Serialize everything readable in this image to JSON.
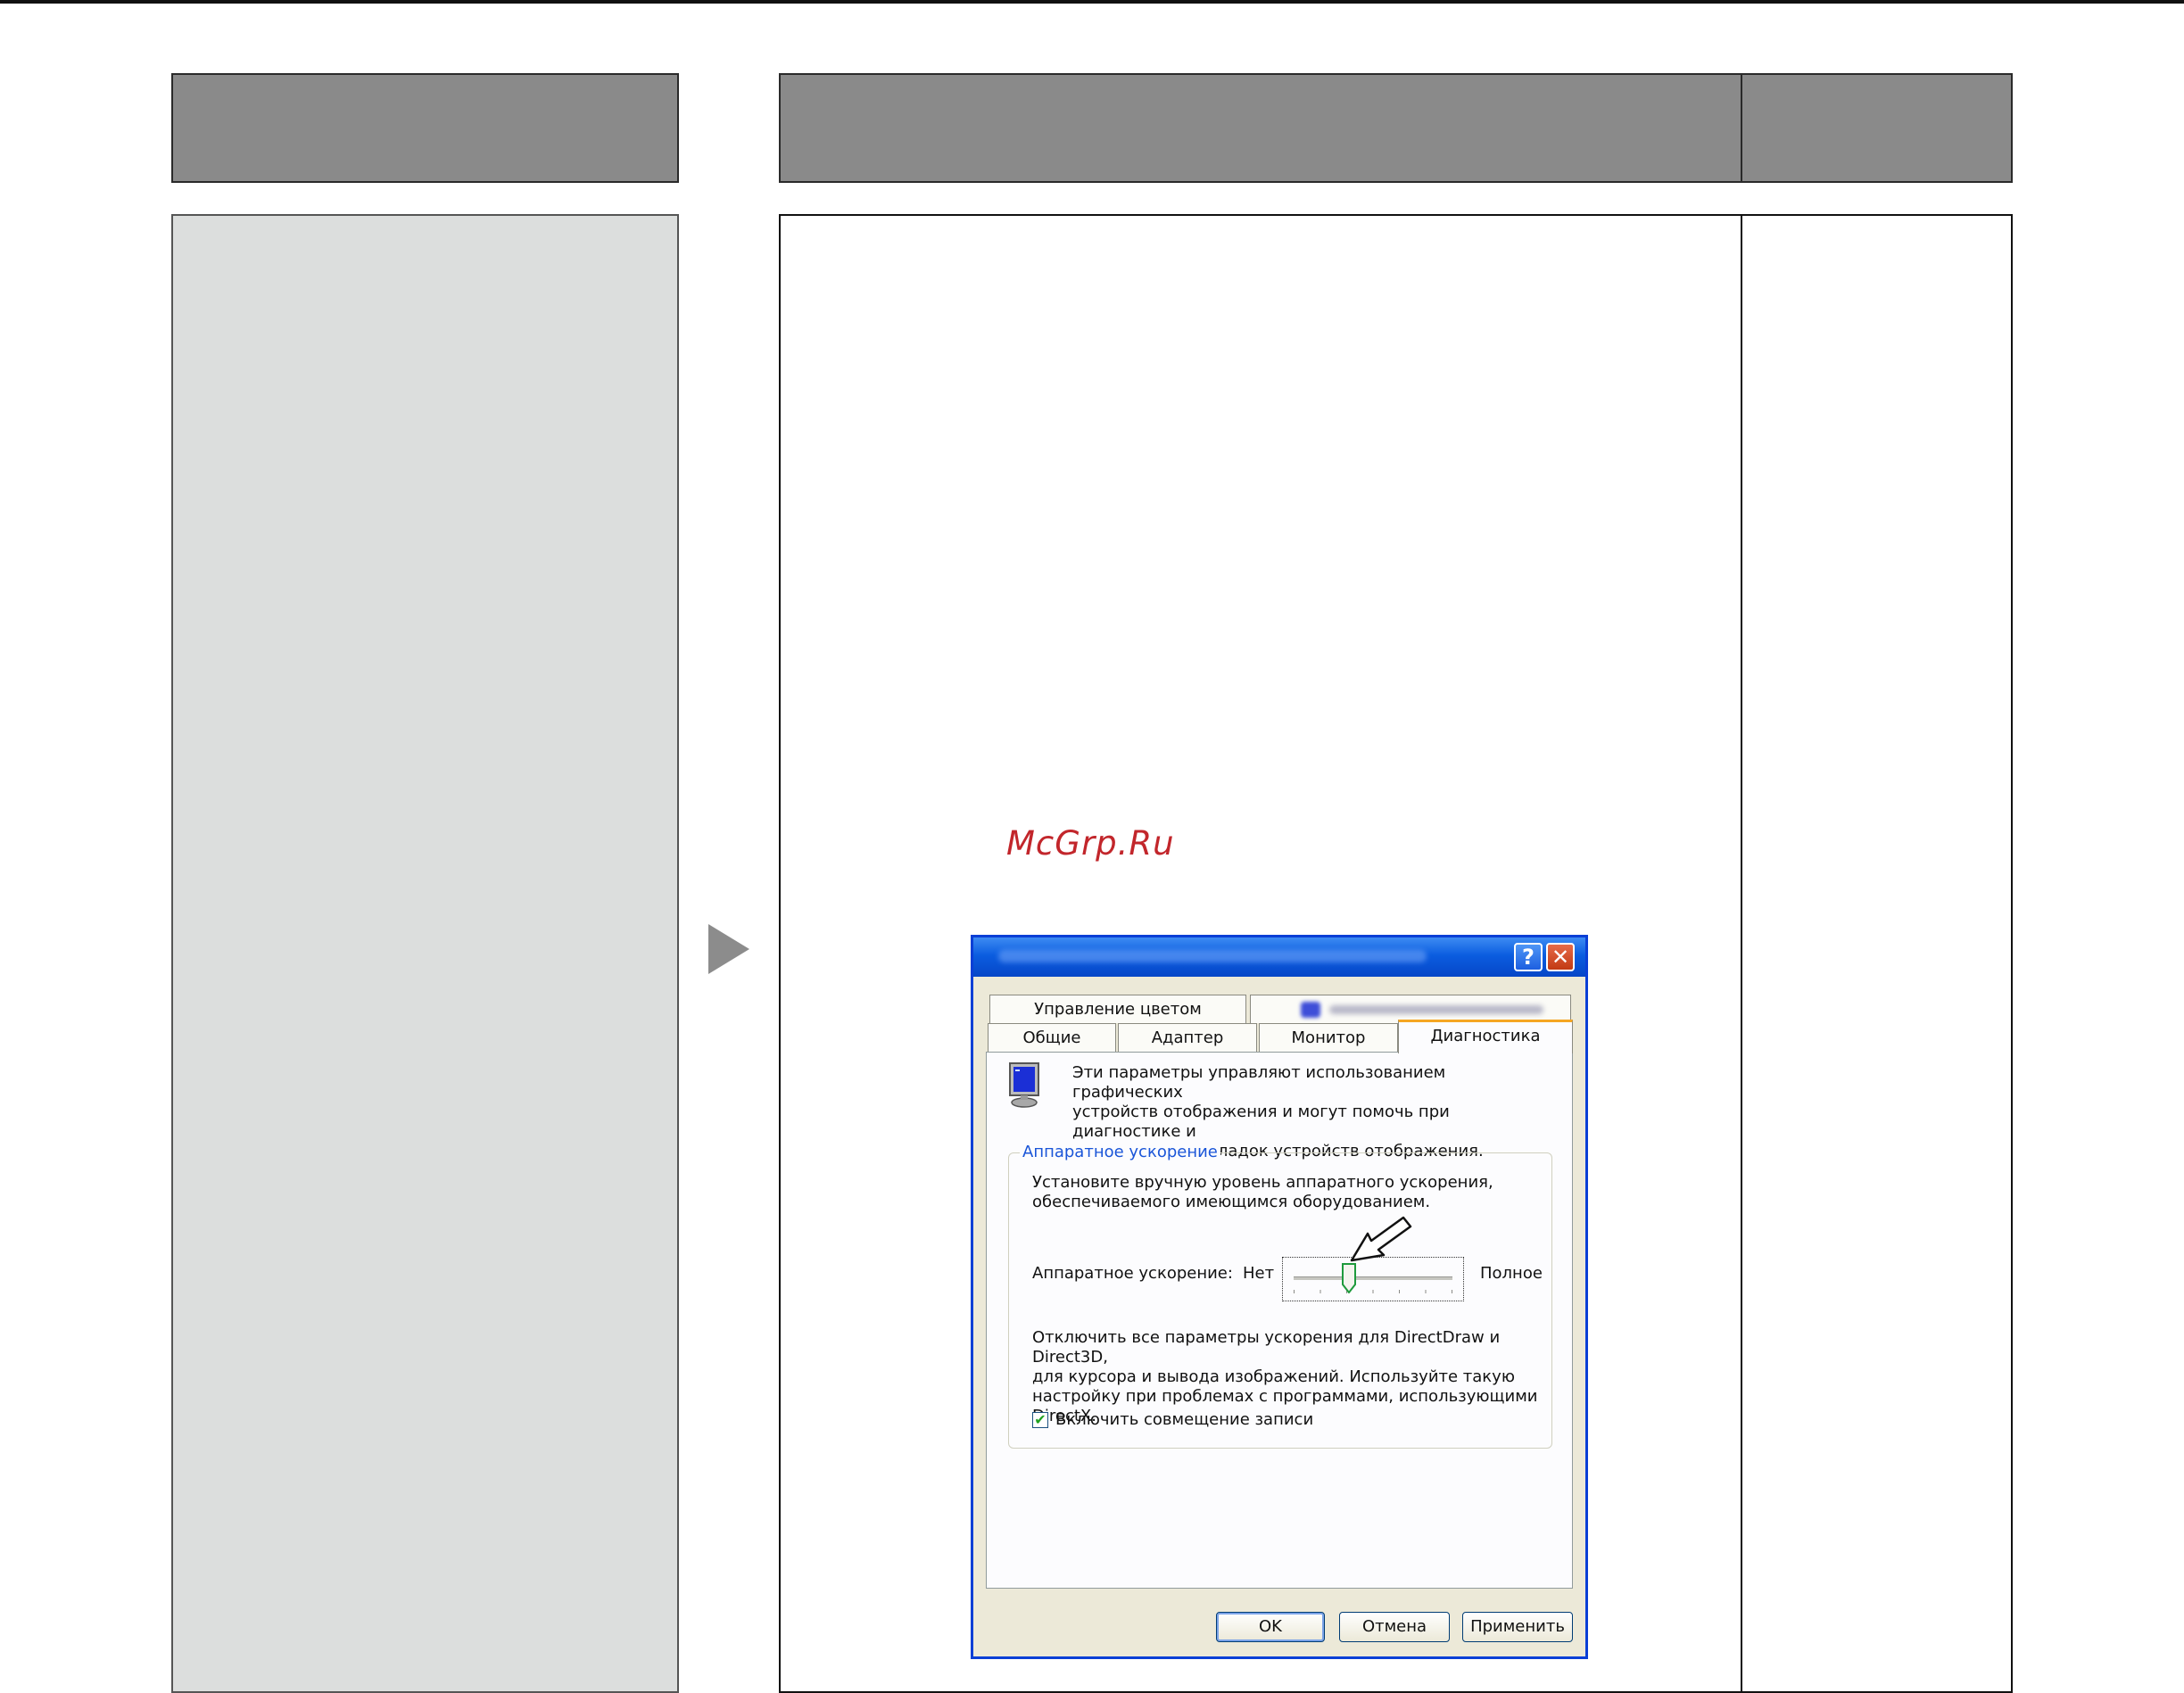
{
  "watermark": "McGrp.Ru",
  "dialog": {
    "help_symbol": "?",
    "close_symbol": "✕",
    "tabs": {
      "color_management": "Управление цветом",
      "general": "Общие",
      "adapter": "Адаптер",
      "monitor": "Монитор",
      "diagnostics": "Диагностика"
    },
    "active_tab": "Диагностика",
    "intro": "Эти параметры управляют использованием графических\nустройств отображения и могут помочь при диагностике и\nустранении неполадок устройств отображения.",
    "group": {
      "legend": "Аппаратное ускорение",
      "description": "Установите вручную уровень аппаратного ускорения,\nобеспечиваемого имеющимся оборудованием.",
      "slider_label": "Аппаратное ускорение:",
      "slider_min": "Нет",
      "slider_max": "Полное",
      "slider_level": 0.35,
      "disable_text": "Отключить все параметры ускорения для DirectDraw и Direct3D,\nдля курсора и вывода изображений. Используйте такую\nнастройку при проблемах с программами, использующими\nDirectX.",
      "checkbox_label": "Включить совмещение записи",
      "checkbox_checked": true,
      "checkbox_mark": "✔"
    },
    "buttons": {
      "ok": "OK",
      "cancel": "Отмена",
      "apply": "Применить"
    }
  },
  "colors": {
    "header_gray": "#8a8a8a",
    "left_panel": "#dcdedd",
    "watermark": "#c2262b",
    "title_bar": "#0b5de0",
    "accent_link": "#1a55d8"
  }
}
